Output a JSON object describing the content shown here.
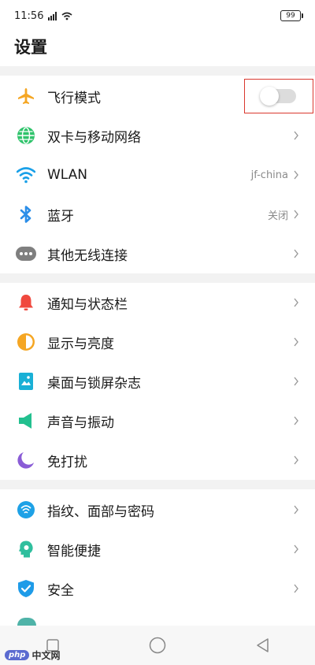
{
  "status": {
    "time": "11:56",
    "battery": "99"
  },
  "header": {
    "title": "设置"
  },
  "sections": [
    {
      "items": [
        {
          "label": "飞行模式",
          "icon": "airplane-icon",
          "toggle": false
        },
        {
          "label": "双卡与移动网络",
          "icon": "globe-icon"
        },
        {
          "label": "WLAN",
          "icon": "wifi-icon",
          "value": "jf-china"
        },
        {
          "label": "蓝牙",
          "icon": "bluetooth-icon",
          "value": "关闭"
        },
        {
          "label": "其他无线连接",
          "icon": "more-dots-icon"
        }
      ]
    },
    {
      "items": [
        {
          "label": "通知与状态栏",
          "icon": "bell-icon"
        },
        {
          "label": "显示与亮度",
          "icon": "brightness-icon"
        },
        {
          "label": "桌面与锁屏杂志",
          "icon": "wallpaper-icon"
        },
        {
          "label": "声音与振动",
          "icon": "speaker-icon"
        },
        {
          "label": "免打扰",
          "icon": "moon-icon"
        }
      ]
    },
    {
      "items": [
        {
          "label": "指纹、面部与密码",
          "icon": "fingerprint-icon"
        },
        {
          "label": "智能便捷",
          "icon": "smart-icon"
        },
        {
          "label": "安全",
          "icon": "shield-icon"
        }
      ]
    }
  ],
  "watermark": {
    "badge": "php",
    "text": "中文网"
  },
  "colors": {
    "airplane": "#f5a623",
    "globe": "#2fc36b",
    "wifi": "#1aa0e8",
    "bluetooth": "#2b8ee8",
    "dots": "#7f7f7f",
    "bell": "#f0493e",
    "brightness": "#f5a623",
    "wallpaper": "#19b0d6",
    "speaker": "#23c08f",
    "moon": "#8a5cd6",
    "fingerprint": "#1ea1e6",
    "smart": "#2fbf9e",
    "shield": "#1e9be8",
    "highlight": "#d9382e"
  }
}
